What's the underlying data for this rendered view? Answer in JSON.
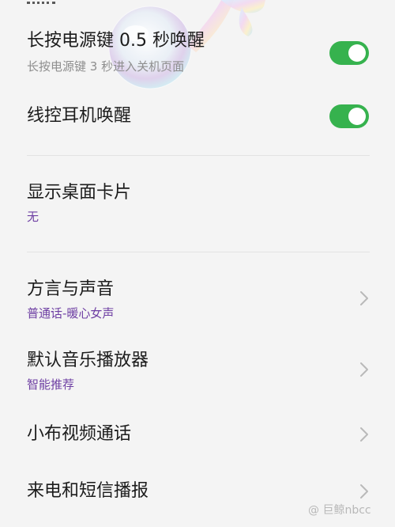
{
  "settings": {
    "long_press_power": {
      "title": "长按电源键 0.5 秒唤醒",
      "subtitle": "长按电源键 3 秒进入关机页面",
      "enabled": true
    },
    "wired_headset": {
      "title": "线控耳机唤醒",
      "enabled": true
    },
    "desktop_card": {
      "title": "显示桌面卡片",
      "value": "无"
    },
    "dialect_voice": {
      "title": "方言与声音",
      "value": "普通话-暖心女声"
    },
    "default_music_player": {
      "title": "默认音乐播放器",
      "value": "智能推荐"
    },
    "video_call": {
      "title": "小布视频通话"
    },
    "call_sms_broadcast": {
      "title": "来电和短信播报"
    }
  },
  "watermark": {
    "text": "@ 巨鲸nbcc"
  },
  "colors": {
    "toggle_on": "#36b24e",
    "value_purple": "#6e3fa3",
    "subtitle_gray": "#8e8e8e",
    "background": "#f4f4f4"
  },
  "icons": {
    "chevron": "chevron-right-icon",
    "decoration": "music-note-decoration"
  }
}
